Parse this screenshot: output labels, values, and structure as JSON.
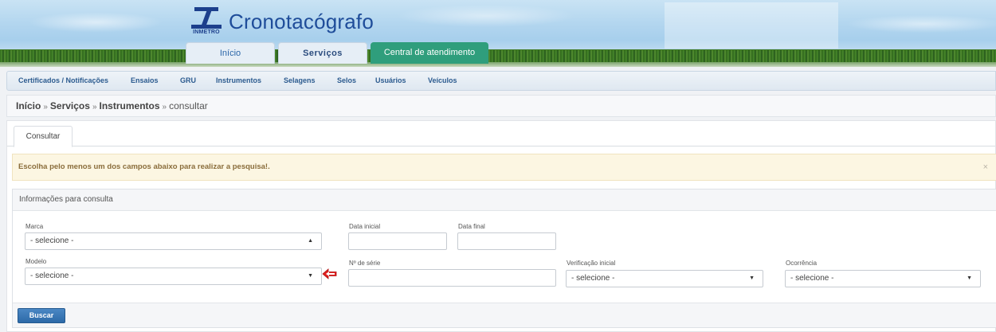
{
  "header": {
    "logo_text": "INMETRO",
    "site_title": "Cronotacógrafo",
    "main_tabs": [
      {
        "label": "Início"
      },
      {
        "label": "Serviços",
        "active": true
      },
      {
        "label": "Central de atendimento"
      }
    ]
  },
  "subnav": {
    "items": [
      {
        "label": "Certificados / Notificações"
      },
      {
        "label": "Ensaios"
      },
      {
        "label": "GRU"
      },
      {
        "label": "Instrumentos"
      },
      {
        "label": "Selagens"
      },
      {
        "label": "Selos"
      },
      {
        "label": "Usuários"
      },
      {
        "label": "Veículos"
      }
    ]
  },
  "breadcrumb": {
    "items": [
      "Início",
      "Serviços",
      "Instrumentos"
    ],
    "current": "consultar",
    "separator": "»"
  },
  "tabs": {
    "consultar": "Consultar"
  },
  "alert": {
    "message": "Escolha pelo menos um dos campos abaixo para realizar a pesquisa!.",
    "close": "×"
  },
  "form": {
    "title": "Informações para consulta",
    "marca": {
      "label": "Marca",
      "value": "- selecione -"
    },
    "data_inicial": {
      "label": "Data inicial",
      "value": ""
    },
    "data_final": {
      "label": "Data final",
      "value": ""
    },
    "modelo": {
      "label": "Modelo",
      "value": "- selecione -"
    },
    "numero_serie": {
      "label": "Nº de série",
      "value": ""
    },
    "verificacao_inicial": {
      "label": "Verificação inicial",
      "value": "- selecione -"
    },
    "ocorrencia": {
      "label": "Ocorrência",
      "value": "- selecione -"
    },
    "submit_label": "Buscar"
  },
  "colors": {
    "accent": "#2f9e7c",
    "link": "#2c5b8f",
    "annotation_arrow": "#e02020"
  }
}
